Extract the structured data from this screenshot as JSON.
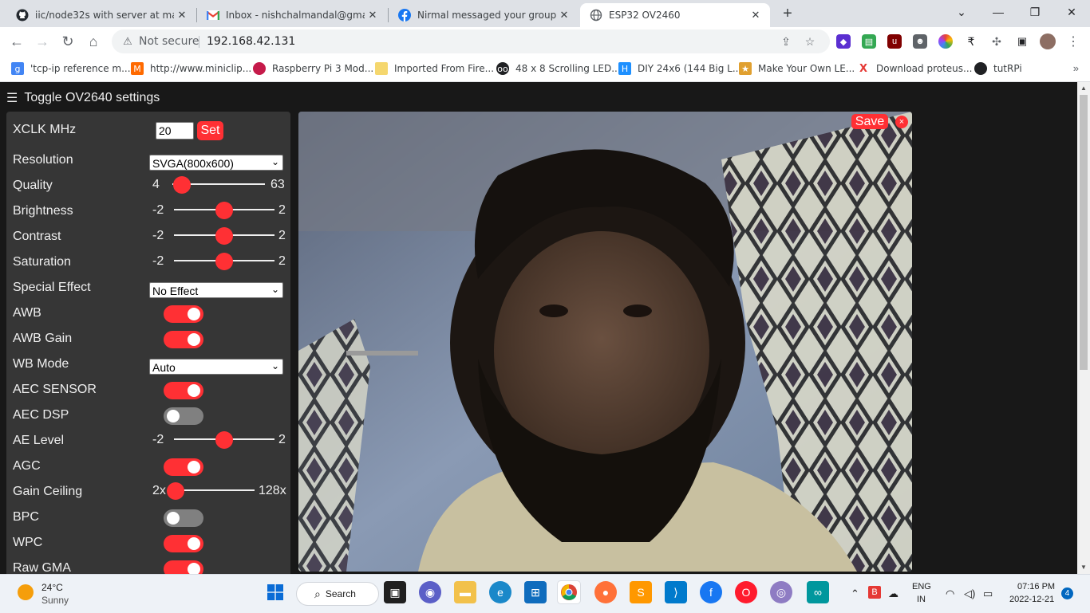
{
  "browser": {
    "tabs": [
      {
        "title": "iic/node32s with server at main ·",
        "icon": "github-icon"
      },
      {
        "title": "Inbox - nishchalmandal@gmail.co",
        "icon": "gmail-icon"
      },
      {
        "title": "Nirmal messaged your group",
        "icon": "facebook-icon"
      },
      {
        "title": "ESP32 OV2460",
        "icon": "globe-icon"
      }
    ],
    "security_label": "Not secure",
    "url": "192.168.42.131",
    "bookmarks": [
      {
        "label": "'tcp-ip reference m...",
        "color": "#4285f4"
      },
      {
        "label": "http://www.miniclip...",
        "color": "#ff6a00"
      },
      {
        "label": "Raspberry Pi 3 Mod...",
        "color": "#c51a4a"
      },
      {
        "label": "Imported From Fire...",
        "color": "#f5c518"
      },
      {
        "label": "48 x 8 Scrolling LED...",
        "color": "#202124"
      },
      {
        "label": "DIY 24x6 (144 Big L...",
        "color": "#1e90ff"
      },
      {
        "label": "Make Your Own LE...",
        "color": "#e0a030"
      },
      {
        "label": "Download proteus...",
        "color": "#e53935"
      },
      {
        "label": "tutRPi",
        "color": "#202124"
      }
    ]
  },
  "camera_page": {
    "toggle_label": "Toggle OV2640 settings",
    "xclk": {
      "label": "XCLK MHz",
      "value": "20",
      "button": "Set"
    },
    "resolution": {
      "label": "Resolution",
      "value": "SVGA(800x600)"
    },
    "quality": {
      "label": "Quality",
      "min": "4",
      "max": "63",
      "value": 10
    },
    "brightness": {
      "label": "Brightness",
      "min": "-2",
      "max": "2",
      "value": 0
    },
    "contrast": {
      "label": "Contrast",
      "min": "-2",
      "max": "2",
      "value": 0
    },
    "saturation": {
      "label": "Saturation",
      "min": "-2",
      "max": "2",
      "value": 0
    },
    "special_effect": {
      "label": "Special Effect",
      "value": "No Effect"
    },
    "awb": {
      "label": "AWB",
      "on": true
    },
    "awb_gain": {
      "label": "AWB Gain",
      "on": true
    },
    "wb_mode": {
      "label": "WB Mode",
      "value": "Auto"
    },
    "aec_sensor": {
      "label": "AEC SENSOR",
      "on": true
    },
    "aec_dsp": {
      "label": "AEC DSP",
      "on": false
    },
    "ae_level": {
      "label": "AE Level",
      "min": "-2",
      "max": "2",
      "value": 0
    },
    "agc": {
      "label": "AGC",
      "on": true
    },
    "gain_ceiling": {
      "label": "Gain Ceiling",
      "min": "2x",
      "max": "128x",
      "value": 0
    },
    "bpc": {
      "label": "BPC",
      "on": false
    },
    "wpc": {
      "label": "WPC",
      "on": true
    },
    "raw_gma": {
      "label": "Raw GMA",
      "on": true
    },
    "save_label": "Save",
    "close_label": "×",
    "accent_color": "#ff3034"
  },
  "taskbar": {
    "temperature": "24°C",
    "condition": "Sunny",
    "search_label": "Search",
    "lang_top": "ENG",
    "lang_bottom": "IN",
    "time": "07:16 PM",
    "date": "2022-12-21",
    "notifications": "4"
  }
}
